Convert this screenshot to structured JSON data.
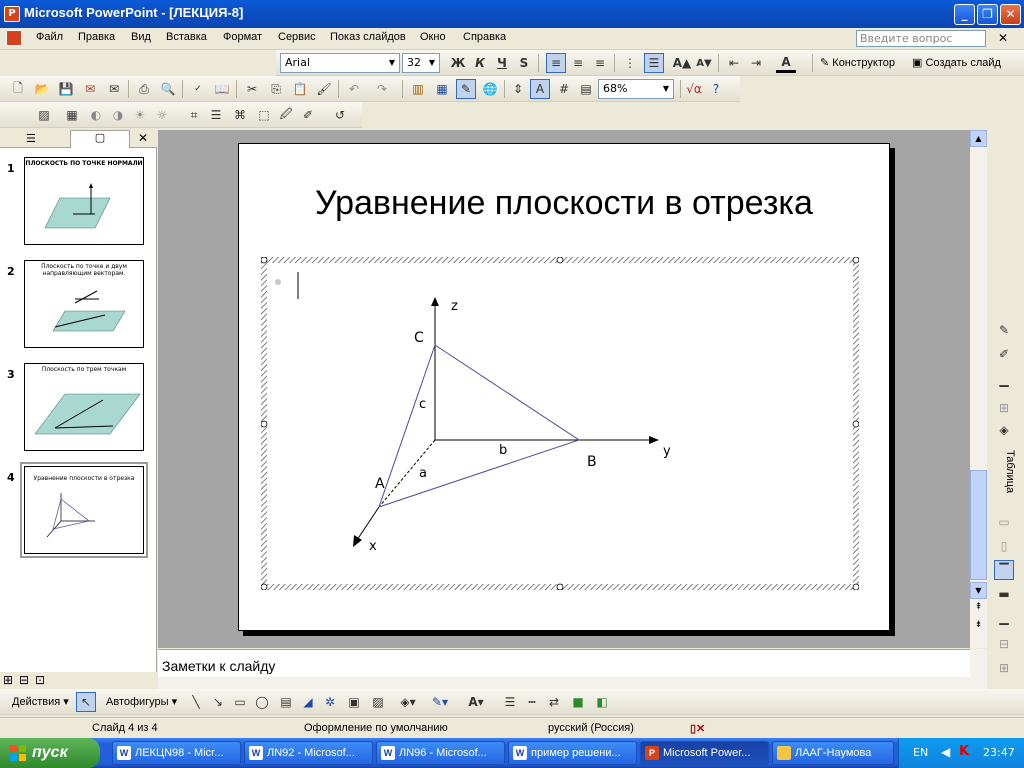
{
  "window": {
    "title": "Microsoft PowerPoint - [ЛЕКЦИЯ-8]",
    "icon_label": "P"
  },
  "menu": {
    "items": [
      "Файл",
      "Правка",
      "Вид",
      "Вставка",
      "Формат",
      "Сервис",
      "Показ слайдов",
      "Окно",
      "Справка"
    ],
    "help_placeholder": "Введите вопрос"
  },
  "formatting": {
    "font": "Arial",
    "size": "32",
    "bold": "Ж",
    "italic": "К",
    "underline": "Ч",
    "shadow": "S",
    "designer": "Конструктор",
    "new_slide": "Создать слайд"
  },
  "standard": {
    "zoom": "68%"
  },
  "slides": [
    {
      "number": "1",
      "title": "ПЛОСКОСТЬ ПО ТОЧКЕ НОРМАЛИ"
    },
    {
      "number": "2",
      "title": "Плоскость по точке и двум направляющим векторам."
    },
    {
      "number": "3",
      "title": "Плоскость по трем точкам"
    },
    {
      "number": "4",
      "title": "Уравнение плоскости в отрезка"
    }
  ],
  "slide": {
    "title": "Уравнение плоскости в отрезка",
    "diagram": {
      "axis_z": "z",
      "axis_y": "y",
      "axis_x": "x",
      "point_c": "C",
      "point_b": "B",
      "point_a": "A",
      "seg_c": "c",
      "seg_b": "b",
      "seg_a": "a"
    }
  },
  "notes": {
    "placeholder": "Заметки к слайду"
  },
  "taskpane": {
    "label": "Таблица"
  },
  "drawing": {
    "actions": "Действия",
    "autoshapes": "Автофигуры"
  },
  "status": {
    "slide": "Слайд 4 из 4",
    "design": "Оформление по умолчанию",
    "language": "русский (Россия)"
  },
  "taskbar": {
    "start": "пуск",
    "tasks": [
      "ЛЕКЦN98 - Micr...",
      "ЛN92 - Microsof...",
      "ЛN96 - Microsof...",
      "пример решени...",
      "Microsoft Power...",
      "ЛААГ-Наумова"
    ],
    "lang": "EN",
    "time": "23:47"
  },
  "colors": {
    "xp_blue": "#0a5bd8",
    "slide_line": "#4b4b9e",
    "thumb_fill": "#a8d8d0"
  }
}
